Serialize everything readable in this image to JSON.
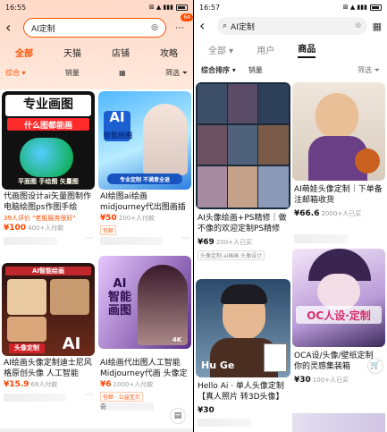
{
  "left": {
    "status": {
      "time": "16:55",
      "icons": "⊠ ▲ ▮▮▮",
      "battery": "54"
    },
    "search": {
      "query": "AI定制",
      "badge": "64"
    },
    "tabs": [
      {
        "label": "全部"
      },
      {
        "label": "天猫"
      },
      {
        "label": "店铺"
      },
      {
        "label": "攻略"
      }
    ],
    "filters": {
      "sort": "综合 ▾",
      "sales": "销量",
      "filter": "筛选"
    },
    "cards": [
      {
        "title": "代画图设计ai矢量图制作电脑绘图ps作图手绘",
        "img_text": "专业画图\n什么图都能画",
        "sub": "平面图 手绘图 矢量图",
        "meta": "39人评价 \"老板服务很好\"",
        "price": "¥100",
        "sales": "400+人付款"
      },
      {
        "title": "AI绘图ai绘画midjourney代出图画插画头像S",
        "img_text": "AI\n智能绘图",
        "sub": "专业定制 不满意全退",
        "meta": "",
        "price": "¥50",
        "sales": "200+人付款",
        "tag": "包邮"
      },
      {
        "title": "AI绘画头像定制迪士尼风格原创头像 人工智能",
        "img_text": "AI智能绘画",
        "sub": "头像定制",
        "meta": "",
        "price": "¥15.9",
        "sales": "69人付款"
      },
      {
        "title": "AI绘画代出图人工智能Midjourney代画 头像定",
        "img_text": "AI\n智能\n画图",
        "sub": "4K",
        "meta": "",
        "price": "¥6",
        "sales": "1000+人付款",
        "tag": "包邮 · 公益宝贝"
      }
    ],
    "shop1": "",
    "shop2": "奇"
  },
  "right": {
    "status": {
      "time": "16:57",
      "icons": "⊠ ▲ ▮▮▮",
      "battery": "54"
    },
    "search": {
      "query": "AI定制"
    },
    "tabs": [
      {
        "label": "全部 ▾"
      },
      {
        "label": "用户"
      },
      {
        "label": "商品"
      }
    ],
    "filters": {
      "sort": "综合排序 ▾",
      "sales": "销量",
      "filter": "筛选"
    },
    "cards": [
      {
        "title": "AI头像绘画+PS精修｜做不像的欢迎定制PS精修",
        "price": "¥69",
        "sales": "200+人已买",
        "tags": "头像定制 ai画画 头像设计"
      },
      {
        "title": "AI萌娃头像定制｜下单备注邮箱收货",
        "price": "¥66.6",
        "sales": "2000+人已买"
      },
      {
        "title": "Hello Ai · 单人头像定制【真人照片 转3D头像】",
        "img_text": "Hu Ge",
        "price": "¥30",
        "sales": ""
      },
      {
        "title": "OCA设/头像/壁纸定制 你的灵感集装箱",
        "img_text": "OC人设·定制",
        "price": "¥30",
        "sales": "100+人已买"
      }
    ]
  },
  "colors": {
    "accent": "#ff5000",
    "price": "#ff4400"
  }
}
